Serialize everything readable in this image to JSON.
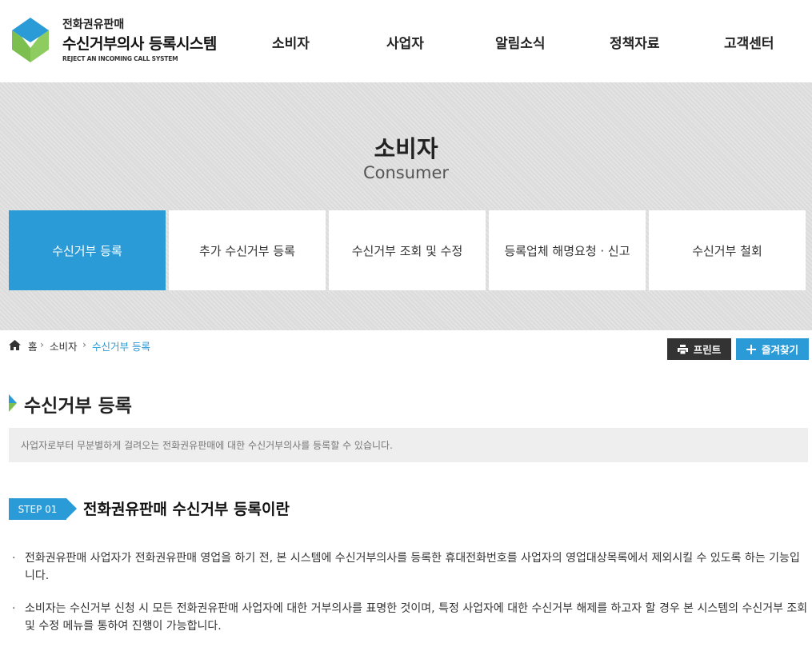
{
  "header": {
    "logo_sub": "전화권유판매",
    "logo_main": "수신거부의사 등록시스템",
    "logo_en": "REJECT AN INCOMING CALL SYSTEM",
    "nav": [
      "소비자",
      "사업자",
      "알림소식",
      "정책자료",
      "고객센터"
    ]
  },
  "hero": {
    "title": "소비자",
    "subtitle": "Consumer",
    "tabs": [
      "수신거부 등록",
      "추가 수신거부 등록",
      "수신거부 조회 및 수정",
      "등록업체 해명요청 · 신고",
      "수신거부 철회"
    ],
    "active_tab": 0
  },
  "location": {
    "home": "홈",
    "level1": "소비자",
    "current": "수신거부 등록"
  },
  "buttons": {
    "print": "프린트",
    "favorite": "즐겨찾기"
  },
  "page": {
    "title": "수신거부 등록",
    "description": "사업자로부터 무분별하게 걸려오는 전화권유판매에 대한 수신거부의사를 등록할 수 있습니다."
  },
  "step": {
    "badge": "STEP 01",
    "title": "전화권유판매 수신거부 등록이란"
  },
  "bullets": [
    "전화권유판매 사업자가 전화권유판매 영업을 하기 전, 본 시스템에 수신거부의사를 등록한 휴대전화번호를 사업자의 영업대상목록에서 제외시킬 수 있도록 하는 기능입니다.",
    "소비자는 수신거부 신청 시 모든 전화권유판매 사업자에 대한 거부의사를 표명한 것이며, 특정 사업자에 대한 수신거부 해제를 하고자 할 경우 본 시스템의 수신거부 조회 및 수정 메뉴를 통하여 진행이 가능합니다."
  ],
  "colors": {
    "accent": "#2b9bd8",
    "logo_green": "#7cbf4e",
    "dark_button": "#333333"
  },
  "icons": {
    "logo": "diamond-logo-icon",
    "home": "home-icon",
    "print": "printer-icon",
    "favorite": "plus-icon",
    "title_marker": "chevron-marker-icon"
  }
}
